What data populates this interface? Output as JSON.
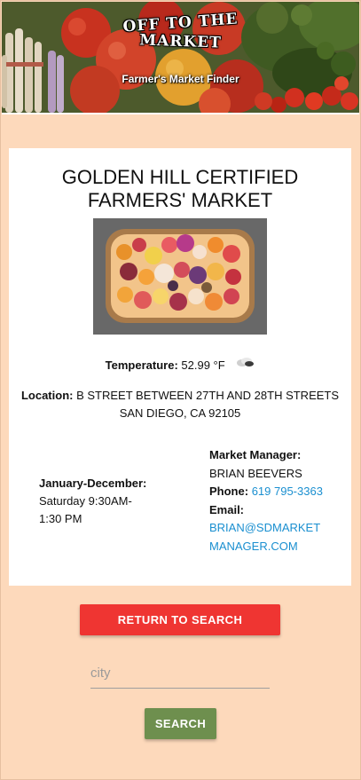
{
  "header": {
    "logo_line1": "OFF TO THE",
    "logo_line2": "MARKET",
    "subtitle": "Farmer's Market Finder"
  },
  "market": {
    "name": "GOLDEN HILL CERTIFIED FARMERS' MARKET",
    "temperature_label": "Temperature:",
    "temperature_value": "52.99 °F",
    "weather_icon": "cloud-icon",
    "location_label": "Location:",
    "location_line1": "B STREET BETWEEN 27TH AND 28TH STREETS",
    "location_line2": "SAN DIEGO, CA 92105",
    "season_label": "January-December:",
    "schedule": "Saturday 9:30AM-1:30 PM",
    "manager_label": "Market Manager:",
    "manager_name": "BRIAN BEEVERS",
    "phone_label": "Phone:",
    "phone": "619 795-3363",
    "email_label": "Email:",
    "email": "BRIAN@SDMARKETMANAGER.COM"
  },
  "actions": {
    "return_label": "RETURN TO SEARCH",
    "search_label": "SEARCH"
  },
  "search": {
    "placeholder": "city",
    "value": ""
  },
  "colors": {
    "page_background": "#fdd9bb",
    "return_button": "#ef3532",
    "search_button": "#6e8f4e",
    "link": "#1a8fd0"
  }
}
